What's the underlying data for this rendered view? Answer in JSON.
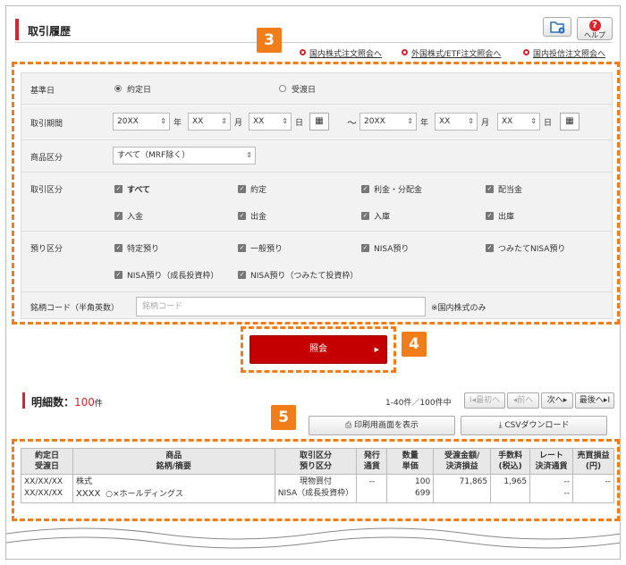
{
  "header": {
    "title": "取引履歴",
    "help_label": "ヘルプ"
  },
  "badges": {
    "search": "3",
    "submit": "4",
    "detail": "5"
  },
  "links": [
    "国内株式注文照会へ",
    "外国株式/ETF注文照会へ",
    "国内投信注文照会へ"
  ],
  "form": {
    "base_date": {
      "label": "基準日",
      "options": [
        "約定日",
        "受渡日"
      ],
      "selected": "約定日"
    },
    "period": {
      "label": "取引期間",
      "from": {
        "year": "20XX",
        "month": "XX",
        "day": "XX"
      },
      "to": {
        "year": "20XX",
        "month": "XX",
        "day": "XX"
      },
      "units": {
        "year": "年",
        "month": "月",
        "day": "日"
      },
      "separator": "〜"
    },
    "product": {
      "label": "商品区分",
      "value": "すべて（MRF除く）"
    },
    "trade_type": {
      "label": "取引区分",
      "items": [
        "すべて",
        "約定",
        "利金・分配金",
        "配当金",
        "入金",
        "出金",
        "入庫",
        "出庫"
      ]
    },
    "deposit_type": {
      "label": "預り区分",
      "items": [
        "特定預り",
        "一般預り",
        "NISA預り",
        "つみたてNISA預り",
        "NISA預り（成長投資枠）",
        "NISA預り（つみたて投資枠）"
      ]
    },
    "code": {
      "label": "銘柄コード（半角英数）",
      "placeholder": "銘柄コード",
      "note": "※国内株式のみ"
    }
  },
  "submit_label": "照会",
  "details": {
    "title": "明細数：",
    "count": "100",
    "unit": "件",
    "range": "1-40件／100件中",
    "pager": {
      "first": "最初へ",
      "prev": "前へ",
      "next": "次へ",
      "last": "最後へ"
    },
    "print_label": "印刷用画面を表示",
    "csv_label": "CSVダウンロード"
  },
  "table": {
    "headers": [
      [
        "約定日",
        "受渡日"
      ],
      [
        "商品",
        "銘柄/摘要"
      ],
      [
        "取引区分",
        "預り区分"
      ],
      [
        "発行",
        "通貨"
      ],
      [
        "数量",
        "単価"
      ],
      [
        "受渡金額/",
        "決済損益"
      ],
      [
        "手数料",
        "(税込)"
      ],
      [
        "レート",
        "決済通貨"
      ],
      [
        "売買損益",
        "(円)"
      ]
    ],
    "row": {
      "date1": "XX/XX/XX",
      "date2": "XX/XX/XX",
      "product": "株式",
      "ticker": "XXXX",
      "company": "○×ホールディングス",
      "trade": "現物買付",
      "deposit": "NISA（成長投資枠）",
      "currency": "--",
      "qty": "100",
      "price": "699",
      "amount": "71,865",
      "fee": "1,965",
      "rate1": "--",
      "rate2": "--",
      "pl": "--"
    }
  },
  "colors": {
    "accent": "#d9232d",
    "highlight": "#f07d19",
    "submit": "#c40000"
  }
}
